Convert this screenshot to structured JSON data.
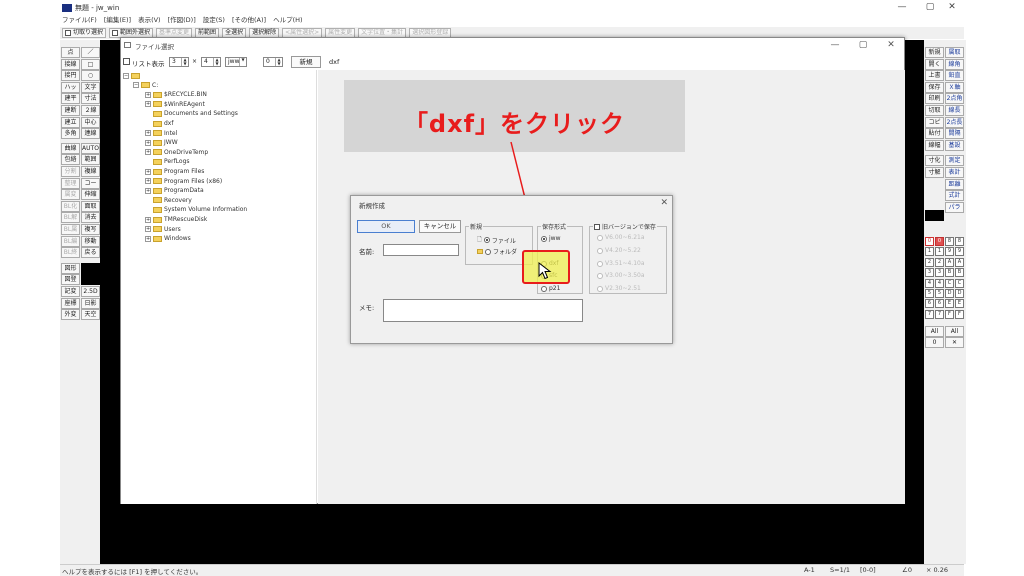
{
  "app": {
    "title": "無題 - jw_win",
    "icon": "jw-app-icon",
    "window_controls": [
      "—",
      "▢",
      "✕"
    ]
  },
  "menu": [
    "ファイル(F)",
    "[編集(E)]",
    "表示(V)",
    "[作図(D)]",
    "設定(S)",
    "[その他(A)]",
    "ヘルプ(H)"
  ],
  "toolbar": [
    {
      "label": "切取り選択",
      "checkbox": true,
      "dim": false
    },
    {
      "label": "範囲外選択",
      "checkbox": true,
      "dim": false
    },
    {
      "label": "基準点変更",
      "checkbox": false,
      "dim": true
    },
    {
      "label": "前範囲",
      "checkbox": false,
      "dim": false
    },
    {
      "label": "全選択",
      "checkbox": false,
      "dim": false
    },
    {
      "label": "選択解除",
      "checkbox": false,
      "dim": false
    },
    {
      "label": "<属性選択>",
      "checkbox": false,
      "dim": true
    },
    {
      "label": "属性変更",
      "checkbox": false,
      "dim": true
    },
    {
      "label": "文字位置・集計",
      "checkbox": false,
      "dim": true
    },
    {
      "label": "選択図形登録",
      "checkbox": false,
      "dim": true
    }
  ],
  "left_tools": [
    "点",
    "／",
    "接線",
    "□",
    "接円",
    "○",
    "ハッチ",
    "文字",
    "建平",
    "寸法",
    "建断",
    "２線",
    "建立",
    "中心線",
    "多角形",
    "連線",
    "曲線",
    "AUTO",
    "包絡",
    "範囲",
    "分割",
    "複線",
    "整理",
    "コーナー",
    "属変",
    "伸縮",
    "BL化",
    "面取",
    "BL解",
    "消去",
    "BL属",
    "複写",
    "BL編",
    "移動",
    "BL終",
    "戻る",
    "図形",
    "",
    "図登",
    "",
    "記変",
    "2.5D",
    "座標",
    "日影",
    "外変",
    "天空"
  ],
  "right_tools": [
    "新規",
    "開く",
    "上書",
    "保存",
    "印刷",
    "切取",
    "コピー",
    "貼付",
    "線幅",
    "寸化",
    "寸解",
    "Ｚ",
    "",
    "",
    "",
    "",
    "",
    "",
    "",
    "",
    "",
    "",
    "",
    ""
  ],
  "right_tools_b": [
    "属取",
    "線角",
    "鉛直",
    "Ｘ軸",
    "2点角",
    "線長",
    "2点長",
    "間隔",
    "基設",
    "測定",
    "表計",
    "距離",
    "式計",
    "パラメ"
  ],
  "layer_grid": [
    "0",
    "8",
    "1",
    "9",
    "2",
    "A",
    "3",
    "B",
    "4",
    "C",
    "5",
    "D",
    "6",
    "E",
    "7",
    "F"
  ],
  "right_bottom": [
    "All",
    "All",
    "0",
    "✕"
  ],
  "status": {
    "help": "ヘルプを表示するには [F1] を押してください。",
    "scale_a": "A-1",
    "scale_s": "S=1/1",
    "layer": "[0-0]",
    "angle": "∠0",
    "zoom": "× 0.26"
  },
  "file_dialog": {
    "title": "ファイル選択",
    "list_label": "リスト表示",
    "spin1": "3",
    "spin_sep": "×",
    "spin2": "4",
    "ext": "jww",
    "spin3": "0",
    "new_button": "新規",
    "dxf_label": "dxf",
    "tree": [
      {
        "label": "",
        "level": 0,
        "pm": "-"
      },
      {
        "label": "C:",
        "level": 1,
        "pm": "-"
      },
      {
        "label": "$RECYCLE.BIN",
        "level": 2,
        "pm": "+"
      },
      {
        "label": "$WinREAgent",
        "level": 2,
        "pm": "+"
      },
      {
        "label": "Documents and Settings",
        "level": 2,
        "pm": ""
      },
      {
        "label": "dxf",
        "level": 2,
        "pm": ""
      },
      {
        "label": "Intel",
        "level": 2,
        "pm": "+"
      },
      {
        "label": "JWW",
        "level": 2,
        "pm": "+"
      },
      {
        "label": "OneDriveTemp",
        "level": 2,
        "pm": "+"
      },
      {
        "label": "PerfLogs",
        "level": 2,
        "pm": ""
      },
      {
        "label": "Program Files",
        "level": 2,
        "pm": "+"
      },
      {
        "label": "Program Files (x86)",
        "level": 2,
        "pm": "+"
      },
      {
        "label": "ProgramData",
        "level": 2,
        "pm": "+"
      },
      {
        "label": "Recovery",
        "level": 2,
        "pm": ""
      },
      {
        "label": "System Volume Information",
        "level": 2,
        "pm": ""
      },
      {
        "label": "TMRescueDisk",
        "level": 2,
        "pm": "+"
      },
      {
        "label": "Users",
        "level": 2,
        "pm": "+"
      },
      {
        "label": "Windows",
        "level": 2,
        "pm": "+"
      }
    ]
  },
  "annotation": {
    "text": "「dxf」をクリック",
    "color": "#e81c1c"
  },
  "new_dialog": {
    "title": "新規作成",
    "ok": "OK",
    "cancel": "キャンセル",
    "name_label": "名前:",
    "name_value": "",
    "memo_label": "メモ:",
    "memo_value": "",
    "group_new": "新規",
    "opt_file": "ファイル",
    "opt_folder": "フォルダ",
    "group_format": "保存形式",
    "fmt_jww": "jww",
    "fmt_dxf": "dxf",
    "fmt_sfc": "sfc",
    "fmt_p21": "p21",
    "group_old": "旧バージョンで保存",
    "old_versions": [
      "V6.00~6.21a",
      "V4.20~5.22",
      "V3.51~4.10a",
      "V3.00~3.50a",
      "V2.30~2.51"
    ]
  }
}
